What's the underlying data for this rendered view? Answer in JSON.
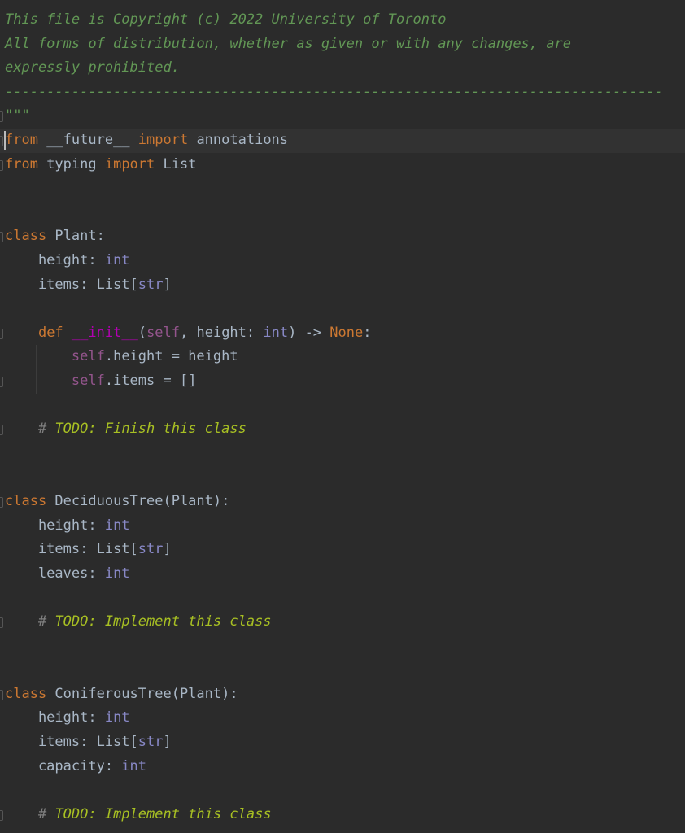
{
  "editor": {
    "language": "python",
    "caret_line": 6,
    "theme": {
      "background": "#2b2b2b",
      "current_line": "#323232",
      "text": "#a9b7c6",
      "keyword": "#cc7832",
      "docstring": "#629755",
      "builtin": "#8888c6",
      "self": "#94558d",
      "magic": "#b200b2",
      "todo": "#a8c023"
    },
    "lines": [
      {
        "tokens": [
          {
            "t": "This file is Copyright (c) 2022 University of Toronto",
            "c": "doc"
          }
        ]
      },
      {
        "tokens": [
          {
            "t": "All forms of distribution, whether as given or with any changes, are",
            "c": "doc"
          }
        ]
      },
      {
        "tokens": [
          {
            "t": "expressly prohibited.",
            "c": "doc"
          }
        ]
      },
      {
        "tokens": [
          {
            "t": "-------------------------------------------------------------------------------",
            "c": "doc"
          }
        ]
      },
      {
        "fold": true,
        "tokens": [
          {
            "t": "\"\"\"",
            "c": "doc"
          }
        ]
      },
      {
        "current": true,
        "fold": true,
        "tokens": [
          {
            "t": "from",
            "c": "kw"
          },
          {
            "t": " __future__ "
          },
          {
            "t": "import",
            "c": "kw"
          },
          {
            "t": " annotations"
          }
        ]
      },
      {
        "fold": true,
        "tokens": [
          {
            "t": "from",
            "c": "kw"
          },
          {
            "t": " typing "
          },
          {
            "t": "import",
            "c": "kw"
          },
          {
            "t": " List"
          }
        ]
      },
      {
        "tokens": []
      },
      {
        "tokens": []
      },
      {
        "fold": true,
        "tokens": [
          {
            "t": "class",
            "c": "kw"
          },
          {
            "t": " Plant:"
          }
        ]
      },
      {
        "tokens": [
          {
            "t": "    height: "
          },
          {
            "t": "int",
            "c": "ty"
          }
        ]
      },
      {
        "tokens": [
          {
            "t": "    items: List["
          },
          {
            "t": "str",
            "c": "ty"
          },
          {
            "t": "]"
          }
        ]
      },
      {
        "tokens": []
      },
      {
        "fold": true,
        "tokens": [
          {
            "t": "    "
          },
          {
            "t": "def",
            "c": "kw"
          },
          {
            "t": " "
          },
          {
            "t": "__init__",
            "c": "mg"
          },
          {
            "t": "("
          },
          {
            "t": "self",
            "c": "sf"
          },
          {
            "t": ", height: "
          },
          {
            "t": "int",
            "c": "ty"
          },
          {
            "t": ") -> "
          },
          {
            "t": "None",
            "c": "kw"
          },
          {
            "t": ":"
          }
        ]
      },
      {
        "tokens": [
          {
            "t": "        "
          },
          {
            "t": "self",
            "c": "sf"
          },
          {
            "t": ".height = height"
          }
        ]
      },
      {
        "fold": true,
        "tokens": [
          {
            "t": "        "
          },
          {
            "t": "self",
            "c": "sf"
          },
          {
            "t": ".items = []"
          }
        ]
      },
      {
        "tokens": []
      },
      {
        "fold": true,
        "tokens": [
          {
            "t": "    "
          },
          {
            "t": "# ",
            "c": "cm"
          },
          {
            "t": "TODO: Finish this class",
            "c": "todo"
          }
        ]
      },
      {
        "tokens": []
      },
      {
        "tokens": []
      },
      {
        "fold": true,
        "tokens": [
          {
            "t": "class",
            "c": "kw"
          },
          {
            "t": " DeciduousTree(Plant):"
          }
        ]
      },
      {
        "tokens": [
          {
            "t": "    height: "
          },
          {
            "t": "int",
            "c": "ty"
          }
        ]
      },
      {
        "tokens": [
          {
            "t": "    items: List["
          },
          {
            "t": "str",
            "c": "ty"
          },
          {
            "t": "]"
          }
        ]
      },
      {
        "tokens": [
          {
            "t": "    leaves: "
          },
          {
            "t": "int",
            "c": "ty"
          }
        ]
      },
      {
        "tokens": []
      },
      {
        "fold": true,
        "tokens": [
          {
            "t": "    "
          },
          {
            "t": "# ",
            "c": "cm"
          },
          {
            "t": "TODO: Implement this class",
            "c": "todo"
          }
        ]
      },
      {
        "tokens": []
      },
      {
        "tokens": []
      },
      {
        "fold": true,
        "tokens": [
          {
            "t": "class",
            "c": "kw"
          },
          {
            "t": " ConiferousTree(Plant):"
          }
        ]
      },
      {
        "tokens": [
          {
            "t": "    height: "
          },
          {
            "t": "int",
            "c": "ty"
          }
        ]
      },
      {
        "tokens": [
          {
            "t": "    items: List["
          },
          {
            "t": "str",
            "c": "ty"
          },
          {
            "t": "]"
          }
        ]
      },
      {
        "tokens": [
          {
            "t": "    capacity: "
          },
          {
            "t": "int",
            "c": "ty"
          }
        ]
      },
      {
        "tokens": []
      },
      {
        "fold": true,
        "tokens": [
          {
            "t": "    "
          },
          {
            "t": "# ",
            "c": "cm"
          },
          {
            "t": "TODO: Implement this class",
            "c": "todo"
          }
        ]
      }
    ]
  }
}
